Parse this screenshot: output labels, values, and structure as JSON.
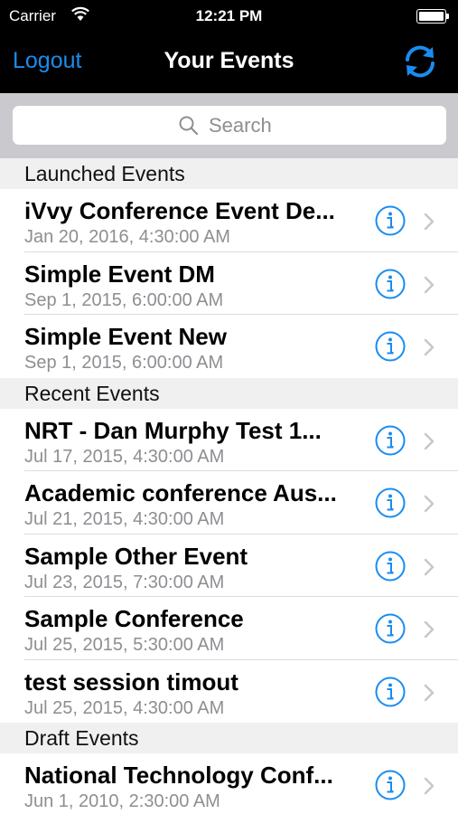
{
  "status_bar": {
    "carrier": "Carrier",
    "time": "12:21 PM"
  },
  "nav": {
    "left_button": "Logout",
    "title": "Your Events",
    "right_icon": "refresh-icon",
    "accent_color": "#1a8cf0"
  },
  "search": {
    "placeholder": "Search"
  },
  "sections": [
    {
      "header": "Launched Events",
      "rows": [
        {
          "title": "iVvy Conference Event De...",
          "date": "Jan 20, 2016, 4:30:00 AM"
        },
        {
          "title": "Simple Event DM",
          "date": "Sep 1, 2015, 6:00:00 AM"
        },
        {
          "title": "Simple Event New",
          "date": "Sep 1, 2015, 6:00:00 AM"
        }
      ]
    },
    {
      "header": "Recent Events",
      "rows": [
        {
          "title": "NRT - Dan Murphy Test 1...",
          "date": "Jul 17, 2015, 4:30:00 AM"
        },
        {
          "title": "Academic conference Aus...",
          "date": "Jul 21, 2015, 4:30:00 AM"
        },
        {
          "title": "Sample Other Event",
          "date": "Jul 23, 2015, 7:30:00 AM"
        },
        {
          "title": "Sample Conference",
          "date": "Jul 25, 2015, 5:30:00 AM"
        },
        {
          "title": "test session timout",
          "date": "Jul 25, 2015, 4:30:00 AM"
        }
      ]
    },
    {
      "header": "Draft Events",
      "rows": [
        {
          "title": "National Technology Conf...",
          "date": "Jun 1, 2010, 2:30:00 AM"
        }
      ]
    }
  ]
}
